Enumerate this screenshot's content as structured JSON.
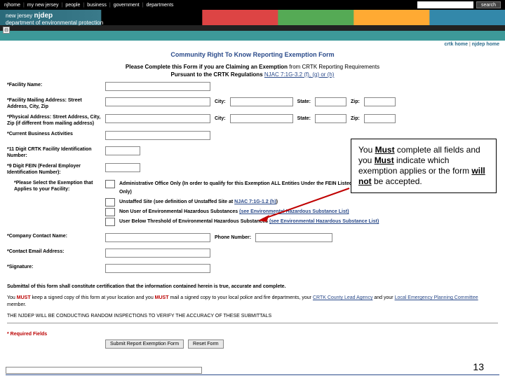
{
  "topnav": {
    "items": [
      "njhome",
      "my new jersey",
      "people",
      "business",
      "government",
      "departments"
    ],
    "search_btn": "search"
  },
  "banner": {
    "dept_small": "new jersey",
    "dept": "njdep",
    "sub": "department of environmental protection"
  },
  "tab_icon": "⊟",
  "homelinks": {
    "a": "crtk home",
    "b": "njdep home"
  },
  "title": "Community Right To Know Reporting Exemption Form",
  "subtitle_lead": "Please Complete this Form if you are Claiming an Exemption",
  "subtitle_tail": " from CRTK Reporting Requirements",
  "subtitle2_lead": "Pursuant to the CRTK Regulations ",
  "subtitle2_link": "NJAC 7:1G-3.2 (f), (g) or (h)",
  "labels": {
    "facility_name": "*Facility Name:",
    "mailing": "*Facility Mailing Address: Street Address, City, Zip",
    "physical": "*Physical Address: Street Address, City, Zip\n(if different from mailing address)",
    "business": "*Current Business Activities",
    "crtk_id": "*11 Digit CRTK Facility Identification Number:",
    "fein": "*9 Digit FEIN (Federal Employer Identification Number):",
    "exempt": "*Please Select the Exemption that Applies to your Facility:",
    "contact": "*Company Contact Name:",
    "email": "*Contact Email Address:",
    "signature": "*Signature:",
    "city": "City:",
    "state": "State:",
    "zip": "Zip:",
    "phone": "Phone Number:"
  },
  "exemptions": {
    "e1": "Administrative Office Only (In order to qualify for this Exemption ALL Entities Under the FEIN Listed Above must be Engaged in Administrative Office Activities Only)",
    "e2a": "Unstaffed Site (see definition of Unstaffed Site at ",
    "e2b": "NJAC 7:1G-1.2 (h)",
    "e2c": ")",
    "e3a": "Non User of Environmental Hazardous Substances ",
    "e3b": "(see Environmental Hazardous Substance List)",
    "e4a": "User Below Threshold of Environmental Hazardous Substances ",
    "e4b": "(see Environmental Hazardous Substance List)"
  },
  "callout": {
    "t1": "You ",
    "must": "Must",
    "t2": " complete all fields and you ",
    "t3": " indicate which exemption applies or the form ",
    "willnot": "will not",
    "t4": " be accepted."
  },
  "notes": {
    "n1a": "Submittal of this form shall constitute certification that the information contained herein is true, accurate and complete.",
    "n2a": "You ",
    "n2must": "MUST",
    "n2b": " keep a signed copy of this form at your location and you ",
    "n2c": " mail a signed copy to your local police and fire departments, your ",
    "n2link1": "CRTK County Lead Agency",
    "n2d": " and your ",
    "n2link2": "Local Emergency Planning Committee",
    "n2e": " member.",
    "n3": "THE NJDEP WILL BE CONDUCTING RANDOM INSPECTIONS TO VERIFY THE ACCURACY OF THESE SUBMITTALS"
  },
  "required": "* Required Fields",
  "buttons": {
    "submit": "Submit Report Exemption Form",
    "reset": "Reset Form"
  },
  "page": "13"
}
